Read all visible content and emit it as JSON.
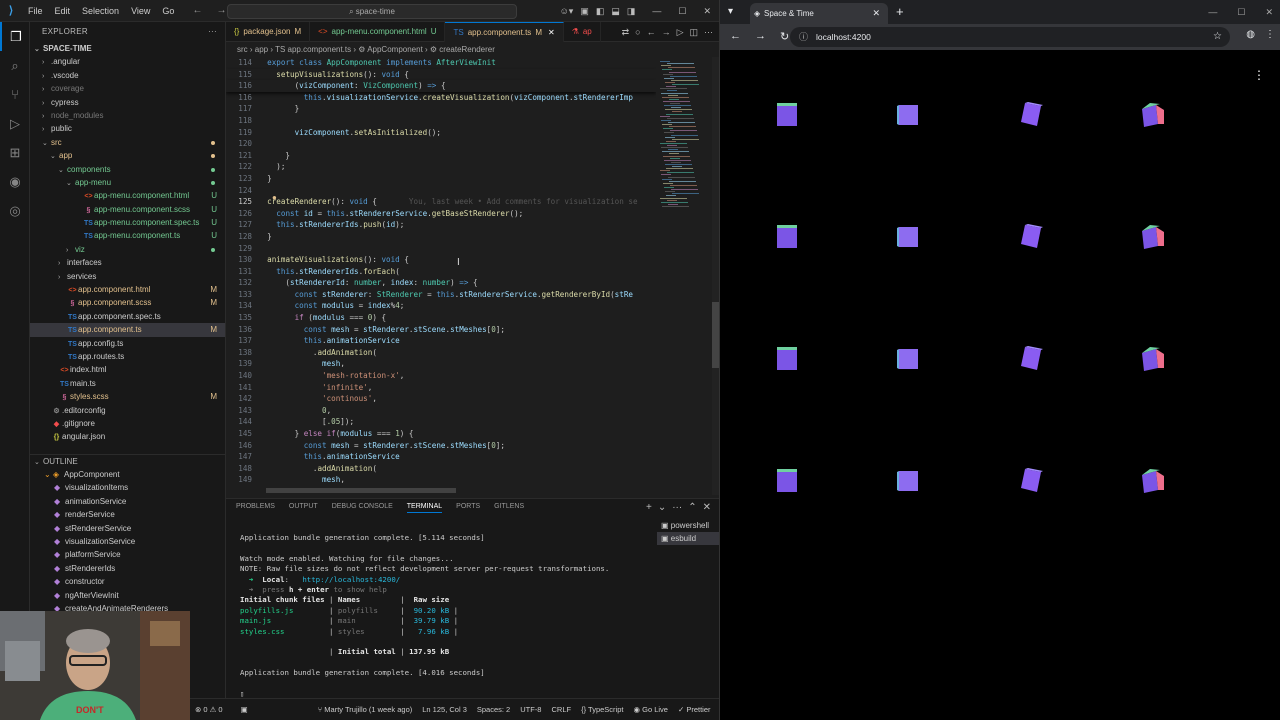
{
  "vscode": {
    "menu": [
      "File",
      "Edit",
      "Selection",
      "View",
      "Go"
    ],
    "search": "space-time",
    "explorer_title": "EXPLORER",
    "project": "SPACE-TIME",
    "tree": [
      {
        "depth": 1,
        "type": "folder",
        "label": ".angular"
      },
      {
        "depth": 1,
        "type": "folder",
        "label": ".vscode"
      },
      {
        "depth": 1,
        "type": "folder",
        "label": "coverage",
        "dim": true
      },
      {
        "depth": 1,
        "type": "folder",
        "label": "cypress"
      },
      {
        "depth": 1,
        "type": "folder",
        "label": "node_modules",
        "dim": true
      },
      {
        "depth": 1,
        "type": "folder",
        "label": "public"
      },
      {
        "depth": 1,
        "type": "folder-open",
        "label": "src",
        "status": "dot",
        "color": "#e2c08d"
      },
      {
        "depth": 2,
        "type": "folder-open",
        "label": "app",
        "status": "dot",
        "color": "#e2c08d"
      },
      {
        "depth": 3,
        "type": "folder-open",
        "label": "components",
        "status": "dot",
        "color": "#73c991"
      },
      {
        "depth": 4,
        "type": "folder-open",
        "label": "app-menu",
        "status": "dot",
        "color": "#73c991"
      },
      {
        "depth": 5,
        "type": "html",
        "label": "app-menu.component.html",
        "status": "U",
        "color": "#73c991"
      },
      {
        "depth": 5,
        "type": "scss",
        "label": "app-menu.component.scss",
        "status": "U",
        "color": "#73c991"
      },
      {
        "depth": 5,
        "type": "spec",
        "label": "app-menu.component.spec.ts",
        "status": "U",
        "color": "#73c991"
      },
      {
        "depth": 5,
        "type": "ts",
        "label": "app-menu.component.ts",
        "status": "U",
        "color": "#73c991"
      },
      {
        "depth": 4,
        "type": "folder",
        "label": "viz",
        "status": "dot",
        "color": "#73c991"
      },
      {
        "depth": 3,
        "type": "folder",
        "label": "interfaces"
      },
      {
        "depth": 3,
        "type": "folder",
        "label": "services"
      },
      {
        "depth": 3,
        "type": "html",
        "label": "app.component.html",
        "status": "M",
        "color": "#e2c08d"
      },
      {
        "depth": 3,
        "type": "scss",
        "label": "app.component.scss",
        "status": "M",
        "color": "#e2c08d"
      },
      {
        "depth": 3,
        "type": "spec",
        "label": "app.component.spec.ts"
      },
      {
        "depth": 3,
        "type": "ts",
        "label": "app.component.ts",
        "status": "M",
        "color": "#e2c08d",
        "selected": true
      },
      {
        "depth": 3,
        "type": "ts",
        "label": "app.config.ts"
      },
      {
        "depth": 3,
        "type": "ts",
        "label": "app.routes.ts"
      },
      {
        "depth": 2,
        "type": "html",
        "label": "index.html"
      },
      {
        "depth": 2,
        "type": "ts",
        "label": "main.ts"
      },
      {
        "depth": 2,
        "type": "scss",
        "label": "styles.scss",
        "status": "M",
        "color": "#e2c08d"
      },
      {
        "depth": 1,
        "type": "gear",
        "label": ".editorconfig"
      },
      {
        "depth": 1,
        "type": "git",
        "label": ".gitignore"
      },
      {
        "depth": 1,
        "type": "json",
        "label": "angular.json"
      }
    ],
    "outline_title": "OUTLINE",
    "outline": [
      {
        "depth": 1,
        "label": "AppComponent",
        "kind": "class"
      },
      {
        "depth": 2,
        "label": "visualizationItems"
      },
      {
        "depth": 2,
        "label": "animationService"
      },
      {
        "depth": 2,
        "label": "renderService"
      },
      {
        "depth": 2,
        "label": "stRendererService"
      },
      {
        "depth": 2,
        "label": "visualizationService"
      },
      {
        "depth": 2,
        "label": "platformService"
      },
      {
        "depth": 2,
        "label": "stRendererIds"
      },
      {
        "depth": 2,
        "label": "constructor"
      },
      {
        "depth": 2,
        "label": "ngAfterViewInit"
      },
      {
        "depth": 2,
        "label": "createAndAnimateRenderers"
      }
    ],
    "tabs": [
      {
        "label": "package.json",
        "mod": "M",
        "icon": "{}",
        "color": "#e2c08d"
      },
      {
        "label": "app-menu.component.html",
        "mod": "U",
        "icon": "<>",
        "color": "#73c991"
      },
      {
        "label": "app.component.ts",
        "mod": "M",
        "icon": "TS",
        "color": "#e2c08d",
        "active": true
      },
      {
        "label": "ap",
        "mod": "",
        "icon": "⚗",
        "color": "#f14c4c"
      }
    ],
    "breadcrumb": "src › app › TS app.component.ts › ⚙ AppComponent › ⚙ createRenderer",
    "code": [
      {
        "n": "114",
        "sticky": true,
        "h": "  <span class='kw'>export class</span> <span class='ty'>AppComponent</span> <span class='kw'>implements</span> <span class='ty'>AfterViewInit</span>"
      },
      {
        "n": "115",
        "sticky": true,
        "h": "    <span class='fn'>setupVisualizations</span>(): <span class='kw'>void</span> {"
      },
      {
        "n": "116",
        "sticky": true,
        "h": "        (<span class='var'>vizComponent</span>: <span class='ty'>VizComponent</span>) <span class='kw'>=></span> {"
      },
      {
        "n": "116",
        "h": "          <span class='kw'>this</span>.<span class='var'>visualizationService</span>.<span class='fn'>createVisualization</span>(<span class='var'>vizComponent</span>.<span class='var'>stRendererImp</span>"
      },
      {
        "n": "117",
        "h": "        }"
      },
      {
        "n": "118",
        "h": ""
      },
      {
        "n": "119",
        "h": "        <span class='var'>vizComponent</span>.<span class='fn'>setAsInitialized</span>();"
      },
      {
        "n": "120",
        "h": ""
      },
      {
        "n": "121",
        "h": "      }"
      },
      {
        "n": "122",
        "h": "    );"
      },
      {
        "n": "123",
        "h": "  }"
      },
      {
        "n": "124",
        "h": ""
      },
      {
        "n": "125",
        "cur": true,
        "h": "  <span class='fn'>createRenderer</span>(): <span class='kw'>void</span> {       <span class='cm'>You, last week • Add comments for visualization se</span>"
      },
      {
        "n": "126",
        "h": "    <span class='kw'>const</span> <span class='var'>id</span> = <span class='kw'>this</span>.<span class='var'>stRendererService</span>.<span class='fn'>getBaseStRenderer</span>();"
      },
      {
        "n": "127",
        "h": "    <span class='kw'>this</span>.<span class='var'>stRendererIds</span>.<span class='fn'>push</span>(<span class='var'>id</span>);"
      },
      {
        "n": "128",
        "h": "  }"
      },
      {
        "n": "129",
        "h": ""
      },
      {
        "n": "130",
        "h": "  <span class='fn'>animateVisualizations</span>(): <span class='kw'>void</span> {"
      },
      {
        "n": "131",
        "h": "    <span class='kw'>this</span>.<span class='var'>stRendererIds</span>.<span class='fn'>forEach</span>("
      },
      {
        "n": "132",
        "h": "      (<span class='var'>stRendererId</span>: <span class='ty'>number</span>, <span class='var'>index</span>: <span class='ty'>number</span>) <span class='kw'>=></span> {"
      },
      {
        "n": "133",
        "h": "        <span class='kw'>const</span> <span class='var'>stRenderer</span>: <span class='ty'>StRenderer</span> = <span class='kw'>this</span>.<span class='var'>stRendererService</span>.<span class='fn'>getRendererById</span>(<span class='var'>stRe</span>"
      },
      {
        "n": "134",
        "h": "        <span class='kw'>const</span> <span class='var'>modulus</span> = <span class='var'>index</span>%<span class='num'>4</span>;"
      },
      {
        "n": "135",
        "h": "        <span class='kw2'>if</span> (<span class='var'>modulus</span> === <span class='num'>0</span>) {"
      },
      {
        "n": "136",
        "h": "          <span class='kw'>const</span> <span class='var'>mesh</span> = <span class='var'>stRenderer</span>.<span class='var'>stScene</span>.<span class='var'>stMeshes</span>[<span class='num'>0</span>];"
      },
      {
        "n": "137",
        "h": "          <span class='kw'>this</span>.<span class='var'>animationService</span>"
      },
      {
        "n": "138",
        "h": "            .<span class='fn'>addAnimation</span>("
      },
      {
        "n": "139",
        "h": "              <span class='var'>mesh</span>,"
      },
      {
        "n": "140",
        "h": "              <span class='str'>'mesh-rotation-x'</span>,"
      },
      {
        "n": "141",
        "h": "              <span class='str'>'infinite'</span>,"
      },
      {
        "n": "142",
        "h": "              <span class='str'>'continous'</span>,"
      },
      {
        "n": "143",
        "h": "              <span class='num'>0</span>,"
      },
      {
        "n": "144",
        "h": "              [<span class='num'>.05</span>]);"
      },
      {
        "n": "145",
        "h": "        } <span class='kw2'>else if</span>(<span class='var'>modulus</span> === <span class='num'>1</span>) {"
      },
      {
        "n": "146",
        "h": "          <span class='kw'>const</span> <span class='var'>mesh</span> = <span class='var'>stRenderer</span>.<span class='var'>stScene</span>.<span class='var'>stMeshes</span>[<span class='num'>0</span>];"
      },
      {
        "n": "147",
        "h": "          <span class='kw'>this</span>.<span class='var'>animationService</span>"
      },
      {
        "n": "148",
        "h": "            .<span class='fn'>addAnimation</span>("
      },
      {
        "n": "149",
        "h": "              <span class='var'>mesh</span>,"
      }
    ],
    "panel_tabs": [
      "PROBLEMS",
      "OUTPUT",
      "DEBUG CONSOLE",
      "TERMINAL",
      "PORTS",
      "GITLENS"
    ],
    "terminal": [
      {
        "h": "Application bundle generation complete. [5.114 seconds]"
      },
      {
        "gap": true
      },
      {
        "h": "Watch mode enabled. Watching for file changes..."
      },
      {
        "h": "NOTE: Raw file sizes do not reflect development server per-request transformations."
      },
      {
        "h": "  <span class='green'>➜</span>  <span class='bold'>Local</span>:   <span class='cyanl'>http://localhost:4200/</span>"
      },
      {
        "h": "  <span class='dim'>➜  press </span><span class='bold'>h + enter</span><span class='dim'> to show help</span>"
      },
      {
        "h": "<span class='bold'>Initial chunk files</span> | <span class='bold'>Names</span>         |  <span class='bold'>Raw size</span>"
      },
      {
        "h": "<span class='green'>polyfills.js</span>        | <span class='dim'>polyfills</span>     |  <span class='cyanl'>90.20 kB</span> |"
      },
      {
        "h": "<span class='green'>main.js</span>             | <span class='dim'>main</span>          |  <span class='cyanl'>39.79 kB</span> |"
      },
      {
        "h": "<span class='green'>styles.css</span>          | <span class='dim'>styles</span>        |   <span class='cyanl'>7.96 kB</span> |"
      },
      {
        "gap": true
      },
      {
        "h": "                    | <span class='bold'>Initial total</span> | <span class='bold'>137.95 kB</span>"
      },
      {
        "gap": true
      },
      {
        "h": "Application bundle generation complete. [4.016 seconds]"
      },
      {
        "gap": true
      },
      {
        "h": "▯"
      }
    ],
    "terminals": [
      "powershell",
      "esbuild"
    ],
    "status": {
      "errors": "⊗ 0 ⚠ 0",
      "blame": "Marty Trujillo (1 week ago)",
      "position": "Ln 125, Col 3",
      "spaces": "Spaces: 2",
      "encoding": "UTF-8",
      "eol": "CRLF",
      "language": "{} TypeScript",
      "golive": "Go Live",
      "prettier": "✓ Prettier"
    }
  },
  "chrome": {
    "tab_title": "Space & Time",
    "url": "localhost:4200"
  },
  "cubes": {
    "columns": 4,
    "rows": 4
  }
}
